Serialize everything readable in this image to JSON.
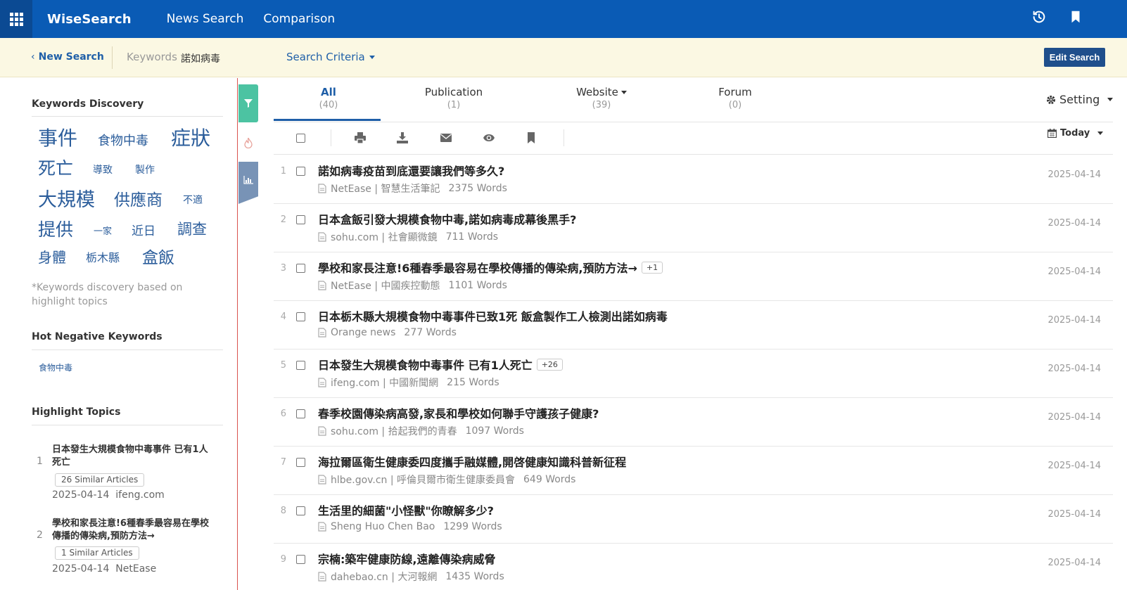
{
  "colors": {
    "topbar": "#0a5bb5",
    "criteria_bar": "#fbf8e3",
    "accent": "#1f5fa8",
    "filter_tab": "#4cc3a2",
    "chart_tab": "#7893b6"
  },
  "header": {
    "brand": "WiseSearch",
    "nav": [
      "News Search",
      "Comparison"
    ],
    "icons": [
      "apps-grid-icon",
      "history-icon",
      "bookmark-icon"
    ]
  },
  "criteria": {
    "new_search": "New Search",
    "keywords_label": "Keywords",
    "keywords_value": "諾如病毒",
    "search_criteria": "Search Criteria",
    "edit_search": "Edit Search"
  },
  "sidebar": {
    "keywords_discovery": {
      "title": "Keywords Discovery",
      "words": [
        "事件",
        "食物中毒",
        "症狀",
        "死亡",
        "導致",
        "製作",
        "大規模",
        "供應商",
        "不適",
        "提供",
        "一家",
        "近日",
        "調查",
        "身體",
        "栃木縣",
        "盒飯"
      ],
      "note": "*Keywords discovery based on highlight topics"
    },
    "hot_negative": {
      "title": "Hot Negative Keywords",
      "words": [
        "食物中毒"
      ]
    },
    "highlight_topics": {
      "title": "Highlight Topics",
      "items": [
        {
          "num": "1",
          "title": "日本發生大規模食物中毒事件 已有1人死亡",
          "badge": "26 Similar Articles",
          "date": "2025-04-14",
          "source": "ifeng.com"
        },
        {
          "num": "2",
          "title": "學校和家長注意!6種春季最容易在學校傳播的傳染病,預防方法→",
          "badge": "1 Similar Articles",
          "date": "2025-04-14",
          "source": "NetEase"
        }
      ]
    }
  },
  "tabs": [
    {
      "label": "All",
      "count": "(40)"
    },
    {
      "label": "Publication",
      "count": "(1)"
    },
    {
      "label": "Website",
      "count": "(39)"
    },
    {
      "label": "Forum",
      "count": "(0)"
    }
  ],
  "setting": "Setting",
  "toolbar": {
    "date_filter": "Today",
    "icons": [
      "print-icon",
      "download-icon",
      "email-icon",
      "eye-icon",
      "bookmark-icon"
    ]
  },
  "articles": [
    {
      "num": "1",
      "title": "諾如病毒疫苗到底還要讓我們等多久?",
      "badge": "",
      "source": "NetEase | 智慧生活筆記",
      "words": "2375 Words",
      "date": "2025-04-14"
    },
    {
      "num": "2",
      "title": "日本盒飯引發大規模食物中毒,諾如病毒成幕後黑手?",
      "badge": "",
      "source": "sohu.com | 社會顯微鏡",
      "words": "711 Words",
      "date": "2025-04-14"
    },
    {
      "num": "3",
      "title": "學校和家長注意!6種春季最容易在學校傳播的傳染病,預防方法→",
      "badge": "+1",
      "source": "NetEase | 中國疾控動態",
      "words": "1101 Words",
      "date": "2025-04-14"
    },
    {
      "num": "4",
      "title": "日本栃木縣大規模食物中毒事件已致1死 飯盒製作工人檢測出諾如病毒",
      "badge": "",
      "source": "Orange news",
      "words": "277 Words",
      "date": "2025-04-14"
    },
    {
      "num": "5",
      "title": "日本發生大規模食物中毒事件 已有1人死亡",
      "badge": "+26",
      "source": "ifeng.com | 中國新聞網",
      "words": "215 Words",
      "date": "2025-04-14"
    },
    {
      "num": "6",
      "title": "春季校園傳染病高發,家長和學校如何聯手守護孩子健康?",
      "badge": "",
      "source": "sohu.com | 拾起我們的青春",
      "words": "1097 Words",
      "date": "2025-04-14"
    },
    {
      "num": "7",
      "title": "海拉爾區衛生健康委四度攜手融媒體,開啓健康知識科普新征程",
      "badge": "",
      "source": "hlbe.gov.cn | 呼倫貝爾市衛生健康委員會",
      "words": "649 Words",
      "date": "2025-04-14"
    },
    {
      "num": "8",
      "title": "生活里的細菌\"小怪獸\"你瞭解多少?",
      "badge": "",
      "source": "Sheng Huo Chen Bao",
      "words": "1299 Words",
      "date": "2025-04-14"
    },
    {
      "num": "9",
      "title": "宗楠:築牢健康防線,遠離傳染病威脅",
      "badge": "",
      "source": "dahebao.cn | 大河報網",
      "words": "1435 Words",
      "date": "2025-04-14"
    }
  ]
}
